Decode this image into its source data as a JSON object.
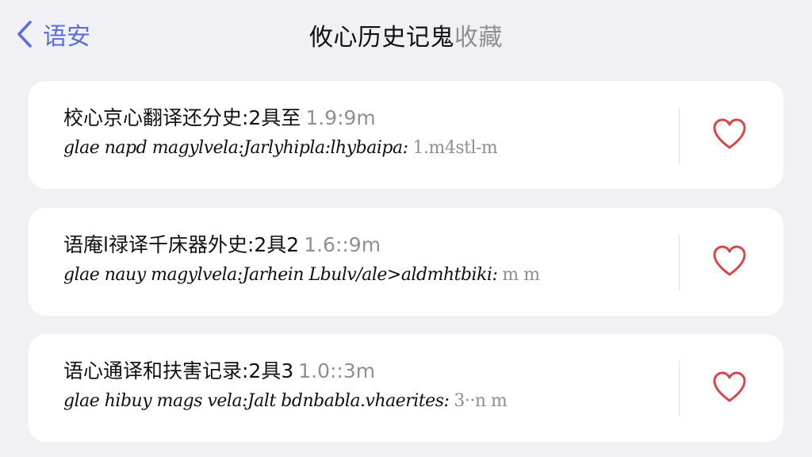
{
  "nav": {
    "back_label": "语安",
    "title_main": "攸心历史记鬼",
    "title_muted": "收藏"
  },
  "colors": {
    "accent": "#5b6fd6",
    "heart": "#d9464e",
    "card": "#ffffff",
    "background": "#f1f1f5"
  },
  "entries": [
    {
      "title": "校心京心翻译还分史:2具至",
      "time": "1.9:9m",
      "subtitle": "glae napd magylvela:Jarlyhipla:lhybaipa:",
      "subtime": "1.m4stl-m",
      "icon": "heart-outline-icon"
    },
    {
      "title": "语庵l禄译千床器外史:2具2",
      "time": "1.6::9m",
      "subtitle": "glae nauy magylvela:Jarhein Lbulv/ale>aldmhtbiki:",
      "subtime": "m m",
      "icon": "heart-outline-icon"
    },
    {
      "title": "语心通译和扶害记录:2具3",
      "time": "1.0::3m",
      "subtitle": "glae hibuy mags vela:Jalt bdnbabla.vhaerites:",
      "subtime": "3··n m",
      "icon": "heart-outline-icon"
    }
  ]
}
